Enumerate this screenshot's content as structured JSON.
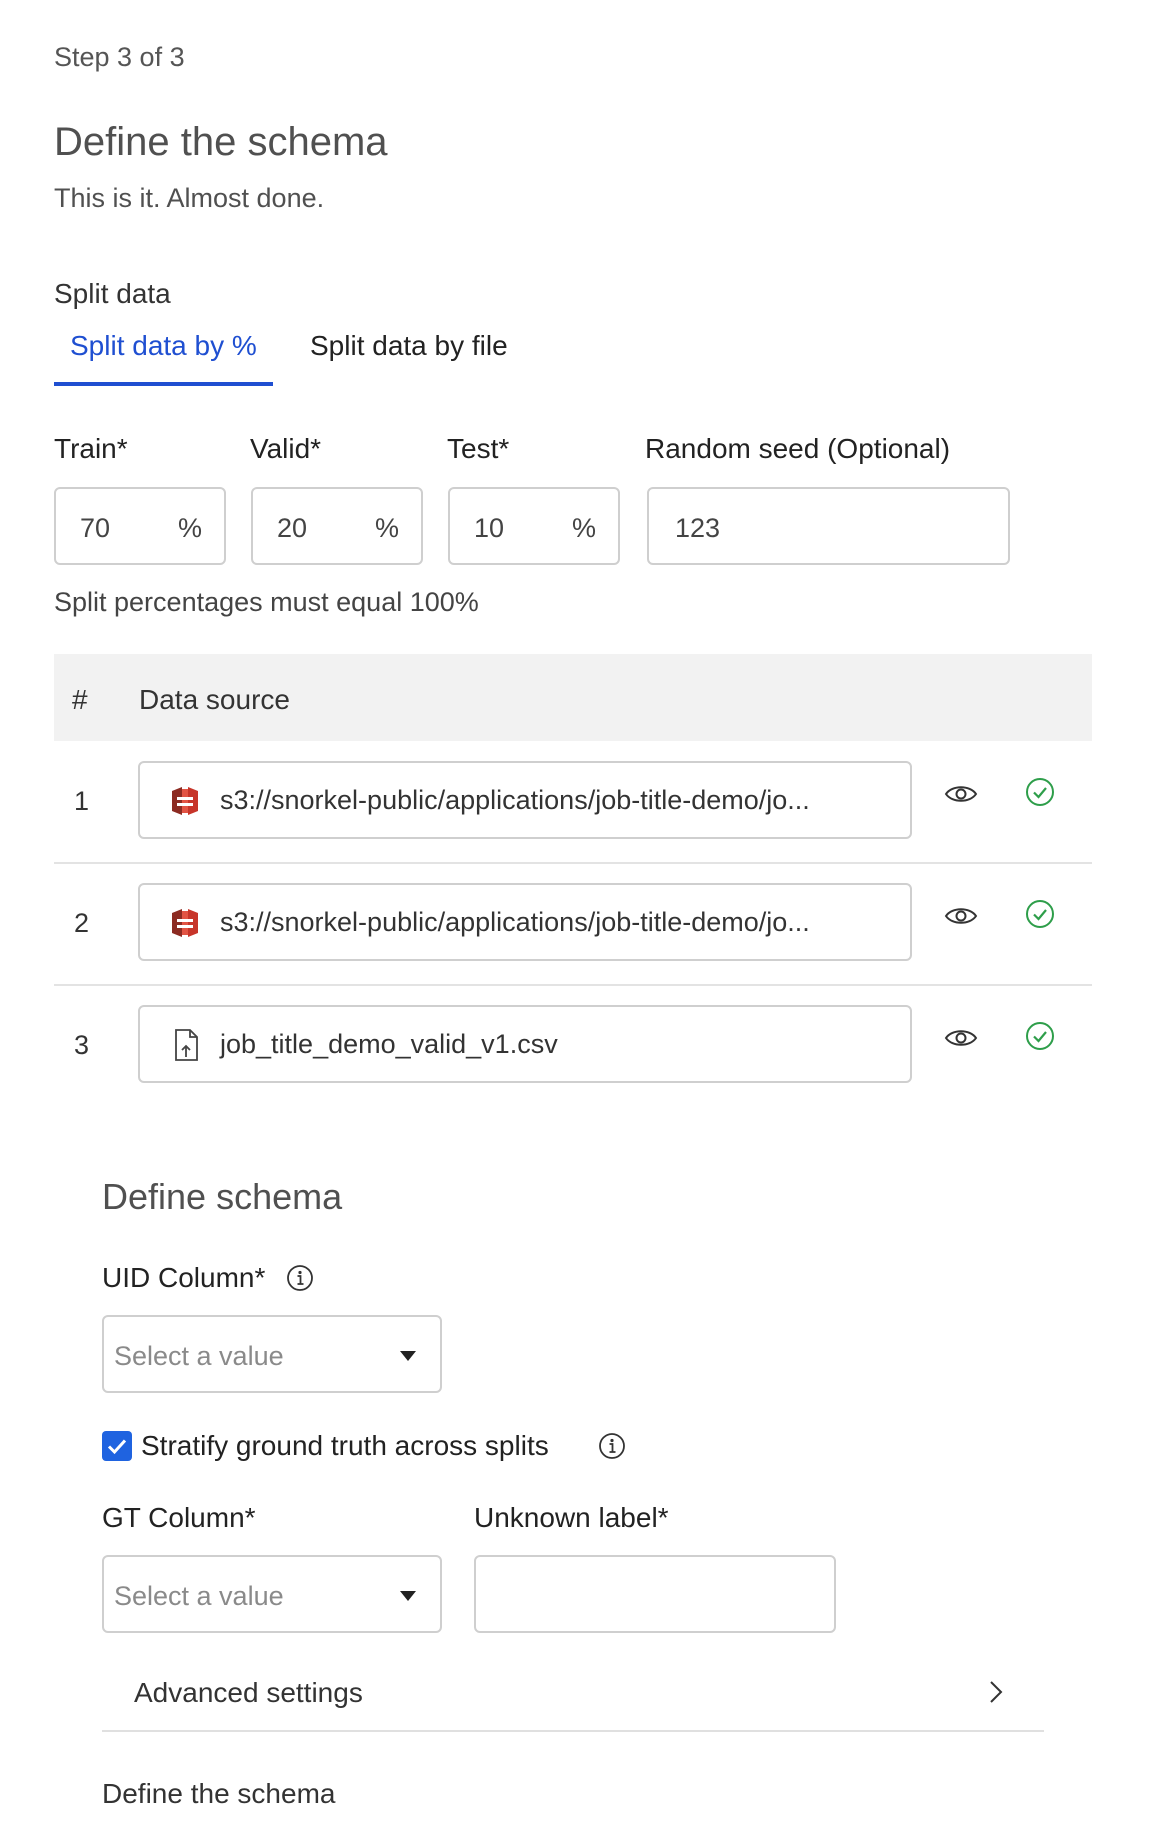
{
  "header": {
    "step": "Step 3 of 3",
    "title": "Define the schema",
    "subtitle": "This is it. Almost done."
  },
  "split": {
    "label": "Split data",
    "tabs": [
      {
        "label": "Split data by %",
        "active": true
      },
      {
        "label": "Split data by file",
        "active": false
      }
    ],
    "fields": {
      "train": {
        "label": "Train*",
        "value": "70",
        "unit": "%"
      },
      "valid": {
        "label": "Valid*",
        "value": "20",
        "unit": "%"
      },
      "test": {
        "label": "Test*",
        "value": "10",
        "unit": "%"
      },
      "seed": {
        "label": "Random seed (Optional)",
        "value": "123"
      }
    },
    "hint": "Split percentages must equal 100%"
  },
  "table": {
    "headers": {
      "num": "#",
      "source": "Data source"
    },
    "rows": [
      {
        "num": "1",
        "source": "s3://snorkel-public/applications/job-title-demo/jo...",
        "icon": "aws-s3-icon"
      },
      {
        "num": "2",
        "source": "s3://snorkel-public/applications/job-title-demo/jo...",
        "icon": "aws-s3-icon"
      },
      {
        "num": "3",
        "source": "job_title_demo_valid_v1.csv",
        "icon": "file-upload-icon"
      }
    ]
  },
  "schema": {
    "heading": "Define schema",
    "uid_label": "UID Column*",
    "uid_placeholder": "Select a value",
    "stratify_label": "Stratify ground truth across splits",
    "stratify_checked": true,
    "gt_label": "GT Column*",
    "gt_placeholder": "Select a value",
    "unknown_label": "Unknown label*",
    "unknown_value": "",
    "advanced": "Advanced settings",
    "footer_title": "Define the schema"
  },
  "colors": {
    "accent": "#1f4fd1",
    "success": "#2e9e4a",
    "s3_red": "#c7352a"
  }
}
